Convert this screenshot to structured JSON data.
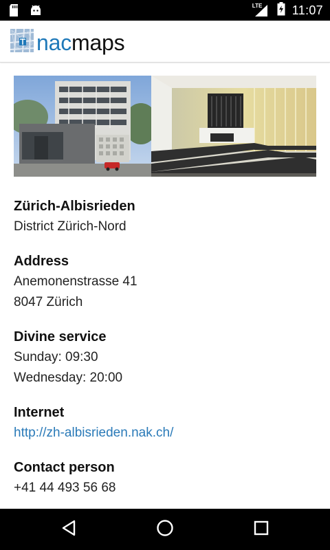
{
  "status_bar": {
    "time": "11:07",
    "network": "LTE",
    "left_icons": [
      "sd-card-icon",
      "android-icon"
    ],
    "right_icons": [
      "signal-icon",
      "battery-charging-icon"
    ]
  },
  "app_bar": {
    "logo_part1": "nac",
    "logo_part2": "maps",
    "brand_color": "#1f79b9"
  },
  "location": {
    "name": "Zürich-Albisrieden",
    "district": "District Zürich-Nord",
    "address_heading": "Address",
    "address_line1": "Anemonenstrasse 41",
    "address_line2": "8047 Zürich",
    "service_heading": "Divine service",
    "service_line1": "Sunday: 09:30",
    "service_line2": "Wednesday: 20:00",
    "internet_heading": "Internet",
    "internet_url": "http://zh-albisrieden.nak.ch/",
    "contact_heading": "Contact person",
    "contact_phone": "+41 44 493 56 68"
  },
  "nav_bar": {
    "buttons": [
      "back-icon",
      "home-icon",
      "recents-icon"
    ]
  }
}
